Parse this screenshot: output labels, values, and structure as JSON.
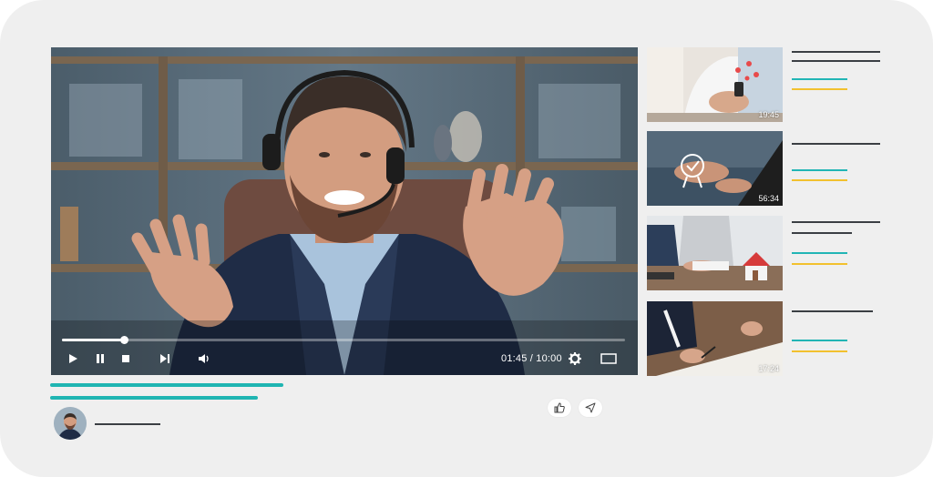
{
  "player": {
    "current_time": "01:45",
    "duration": "10:00",
    "time_display": "01:45 / 10:00",
    "progress_fraction": 0.11,
    "icons": [
      "play-icon",
      "pause-icon",
      "stop-icon",
      "next-icon",
      "volume-icon",
      "settings-icon",
      "fullscreen-icon"
    ]
  },
  "playlist": [
    {
      "duration": "19:45"
    },
    {
      "duration": "56:34"
    },
    {
      "duration": ""
    },
    {
      "duration": "17:24"
    }
  ],
  "actions": {
    "icons": [
      "like-icon",
      "share-icon"
    ]
  },
  "colors": {
    "accent": "#1fb5b2",
    "highlight": "#f2c12e",
    "placeholder_text": "#3b3f44",
    "background": "#efefef"
  }
}
